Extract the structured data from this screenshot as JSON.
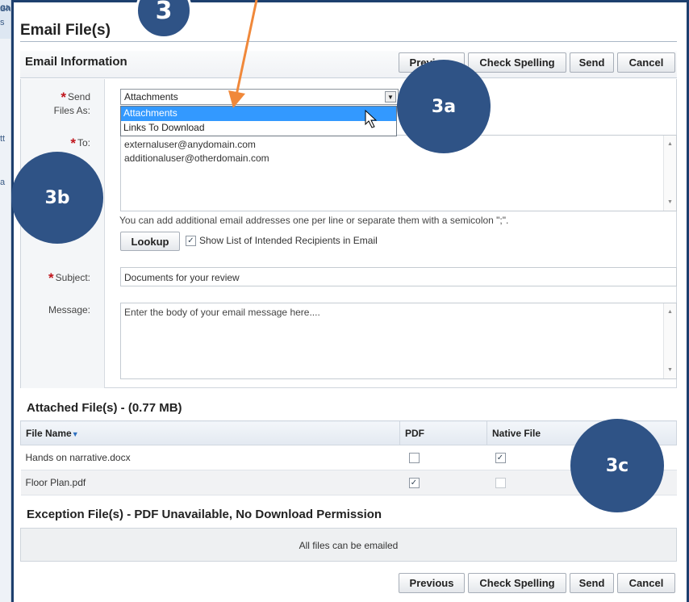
{
  "background_window": {
    "row1_text": "s",
    "row2_text": "oa",
    "row3_text": "Sh",
    "row4_text": "tt",
    "row5_text": "a"
  },
  "dialog": {
    "title": "Email File(s)",
    "section_label": "Email Information",
    "buttons": {
      "previous": "Previous",
      "check_spelling": "Check Spelling",
      "send": "Send",
      "cancel": "Cancel"
    }
  },
  "form": {
    "send_files_as": {
      "label_line1": "Send",
      "label_line2": "Files As:",
      "selected": "Attachments",
      "options": [
        "Attachments",
        "Links To Download"
      ]
    },
    "to": {
      "label": "To:",
      "lines": [
        "externaluser@anydomain.com",
        "additionaluser@otherdomain.com"
      ]
    },
    "hint": "You can add additional email addresses one per line or separate them with a semicolon \";\".",
    "lookup_label": "Lookup",
    "show_list_label": "Show List of Intended Recipients in Email",
    "show_list_checked": true,
    "subject": {
      "label": "Subject:",
      "value": "Documents for your review"
    },
    "message": {
      "label": "Message:",
      "placeholder": "Enter the body of your email message here...."
    },
    "required_marker": "*"
  },
  "attached": {
    "title": "Attached File(s) - (0.77 MB)",
    "columns": [
      "File Name",
      "PDF",
      "Native File"
    ],
    "rows": [
      {
        "name": "Hands on narrative.docx",
        "pdf": false,
        "native": true
      },
      {
        "name": "Floor Plan.pdf",
        "pdf": true,
        "native": false
      }
    ]
  },
  "exception": {
    "title": "Exception File(s) - PDF Unavailable, No Download Permission",
    "empty_text": "All files can be emailed"
  },
  "annotations": {
    "c3": "3",
    "c3a": "3a",
    "c3b": "3b",
    "c3c": "3c",
    "arrow_color": "#f0883a",
    "callout_color": "#2f5386"
  },
  "colors": {
    "frame": "#1d3f6e",
    "selection": "#3399ff",
    "required": "#c0141b"
  }
}
